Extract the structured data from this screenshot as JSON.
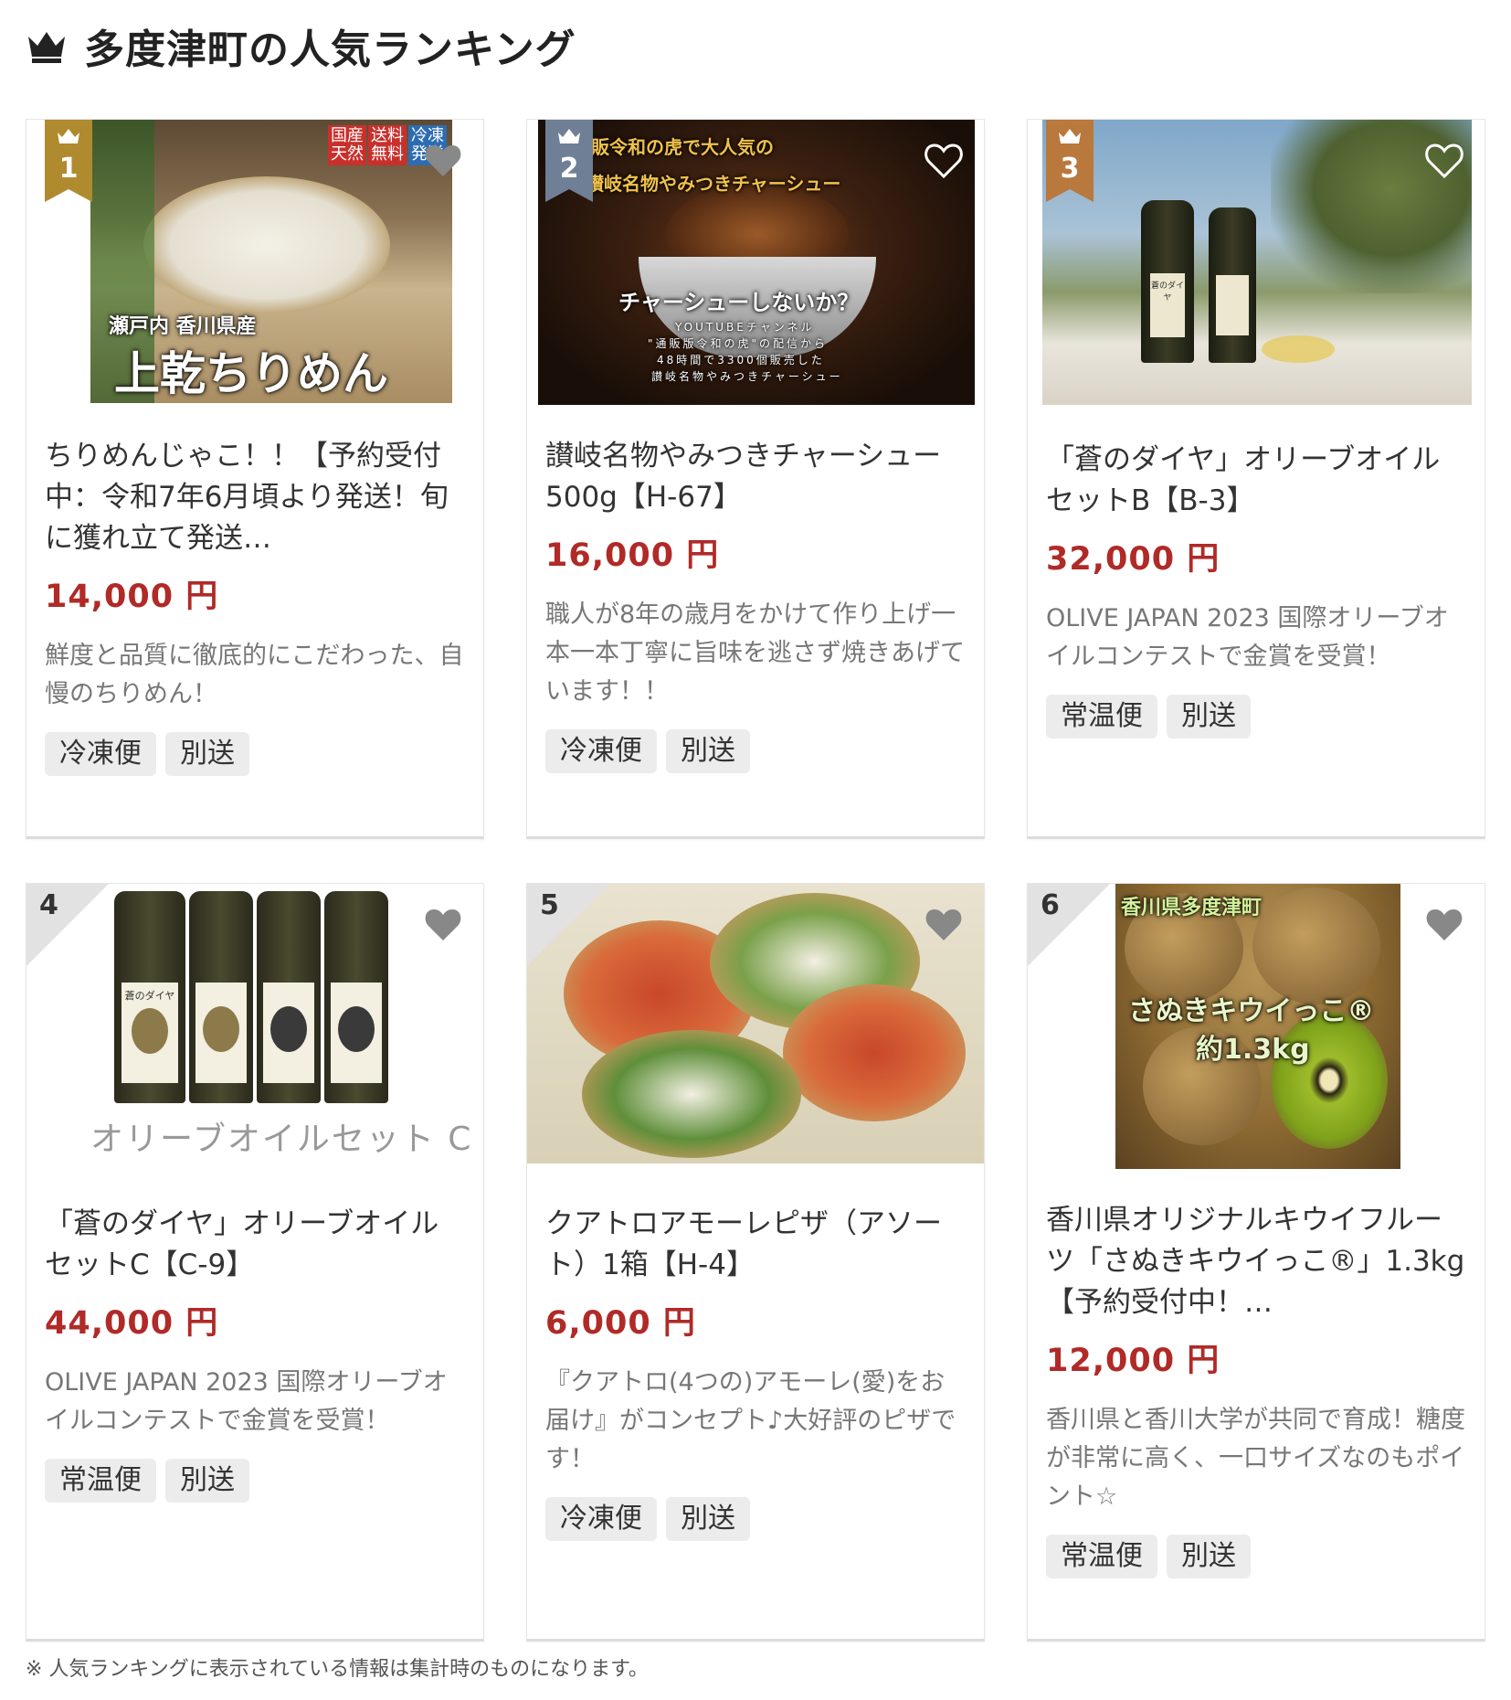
{
  "page": {
    "title": "多度津町の人気ランキング",
    "footnote": "※ 人気ランキングに表示されている情報は集計時のものになります。"
  },
  "colors": {
    "price": "#b02a27",
    "gold": "#b08a2e",
    "silver": "#6f7f95",
    "bronze": "#b9783c"
  },
  "items": [
    {
      "rank": "1",
      "title": "ちりめんじゃこ！！【予約受付中：令和7年6月頃より発送！旬に獲れ立て発送…",
      "price": "14,000 円",
      "desc": "鮮度と品質に徹底的にこだわった、自慢のちりめん！",
      "tags": [
        "冷凍便",
        "別送"
      ],
      "img_text": {
        "a1": "国産",
        "a2": "天然",
        "b1": "送料",
        "b2": "無料",
        "c1": "冷凍",
        "c2": "発送",
        "sub": "瀬戸内 香川県産",
        "main": "上乾ちりめん"
      }
    },
    {
      "rank": "2",
      "title": "讃岐名物やみつきチャーシュー500g【H-67】",
      "price": "16,000 円",
      "desc": "職人が8年の歳月をかけて作り上げ一本一本丁寧に旨味を逃さず焼きあげています！！",
      "tags": [
        "冷凍便",
        "別送"
      ],
      "img_text": {
        "top1": "販令和の虎で大人気の",
        "top2": "讃岐名物やみつきチャーシュー",
        "mid": "チャーシューしないか？",
        "l1": "YOUTUBEチャンネル",
        "l2": "\"通販版令和の虎\"の配信から",
        "l3": "48時間で3300個販売した",
        "l4": "讃岐名物やみつきチャーシュー"
      }
    },
    {
      "rank": "3",
      "title": "「蒼のダイヤ」オリーブオイルセットB【B-3】",
      "price": "32,000 円",
      "desc": "OLIVE JAPAN 2023 国際オリーブオイルコンテストで金賞を受賞！",
      "tags": [
        "常温便",
        "別送"
      ],
      "img_text": {
        "label": "蒼のダイヤ"
      }
    },
    {
      "rank": "4",
      "title": "「蒼のダイヤ」オリーブオイルセットC【C-9】",
      "price": "44,000 円",
      "desc": "OLIVE JAPAN 2023 国際オリーブオイルコンテストで金賞を受賞！",
      "tags": [
        "常温便",
        "別送"
      ],
      "img_text": {
        "label": "蒼のダイヤ",
        "caption": "オリーブオイルセット C"
      }
    },
    {
      "rank": "5",
      "title": "クアトロアモーレピザ（アソート）1箱【H-4】",
      "price": "6,000 円",
      "desc": "『クアトロ(4つの)アモーレ(愛)をお届け』がコンセプト♪大好評のピザです！",
      "tags": [
        "冷凍便",
        "別送"
      ]
    },
    {
      "rank": "6",
      "title": "香川県オリジナルキウイフルーツ「さぬきキウイっこ®」1.3kg【予約受付中！…",
      "price": "12,000 円",
      "desc": "香川県と香川大学が共同で育成！糖度が非常に高く、一口サイズなのもポイント☆",
      "tags": [
        "常温便",
        "別送"
      ],
      "img_text": {
        "top": "香川県多度津町",
        "mid": "さぬきキウイっこ®",
        "wt": "約1.3kg"
      }
    }
  ]
}
